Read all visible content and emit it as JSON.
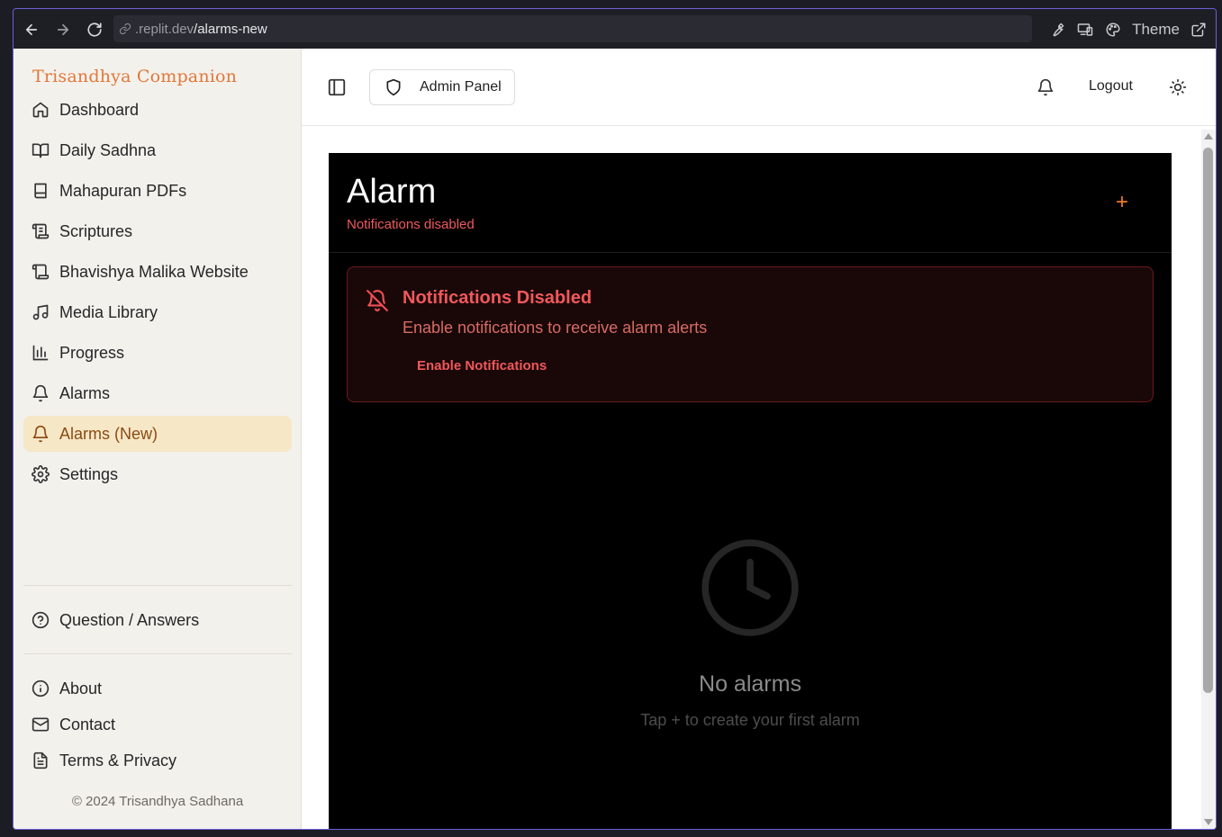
{
  "browser": {
    "url_domain": ".replit.dev",
    "url_path": "/alarms-new",
    "theme_label": "Theme"
  },
  "sidebar": {
    "brand": "Trisandhya Companion",
    "items": [
      {
        "label": "Dashboard",
        "icon": "home-icon"
      },
      {
        "label": "Daily Sadhna",
        "icon": "book-open-icon"
      },
      {
        "label": "Mahapuran PDFs",
        "icon": "book-icon"
      },
      {
        "label": "Scriptures",
        "icon": "scroll-icon"
      },
      {
        "label": "Bhavishya Malika Website",
        "icon": "scroll-icon"
      },
      {
        "label": "Media Library",
        "icon": "music-icon"
      },
      {
        "label": "Progress",
        "icon": "bar-chart-icon"
      },
      {
        "label": "Alarms",
        "icon": "bell-icon"
      },
      {
        "label": "Alarms (New)",
        "icon": "bell-icon",
        "active": true
      },
      {
        "label": "Settings",
        "icon": "gear-icon"
      }
    ],
    "qa_label": "Question / Answers",
    "footer_items": [
      {
        "label": "About",
        "icon": "info-icon"
      },
      {
        "label": "Contact",
        "icon": "mail-icon"
      },
      {
        "label": "Terms & Privacy",
        "icon": "document-icon"
      }
    ],
    "copyright": "© 2024 Trisandhya Sadhana"
  },
  "header": {
    "admin_label": "Admin Panel",
    "logout_label": "Logout"
  },
  "alarm": {
    "title": "Alarm",
    "subtitle": "Notifications disabled",
    "add_symbol": "+",
    "warning": {
      "title": "Notifications Disabled",
      "text": "Enable notifications to receive alarm alerts",
      "action": "Enable Notifications"
    },
    "empty": {
      "title": "No alarms",
      "subtitle": "Tap + to create your first alarm"
    }
  },
  "colors": {
    "accent": "#f07b1f",
    "brand": "#e2773a",
    "danger": "#f2585b",
    "active_bg": "#f6e7c6"
  }
}
